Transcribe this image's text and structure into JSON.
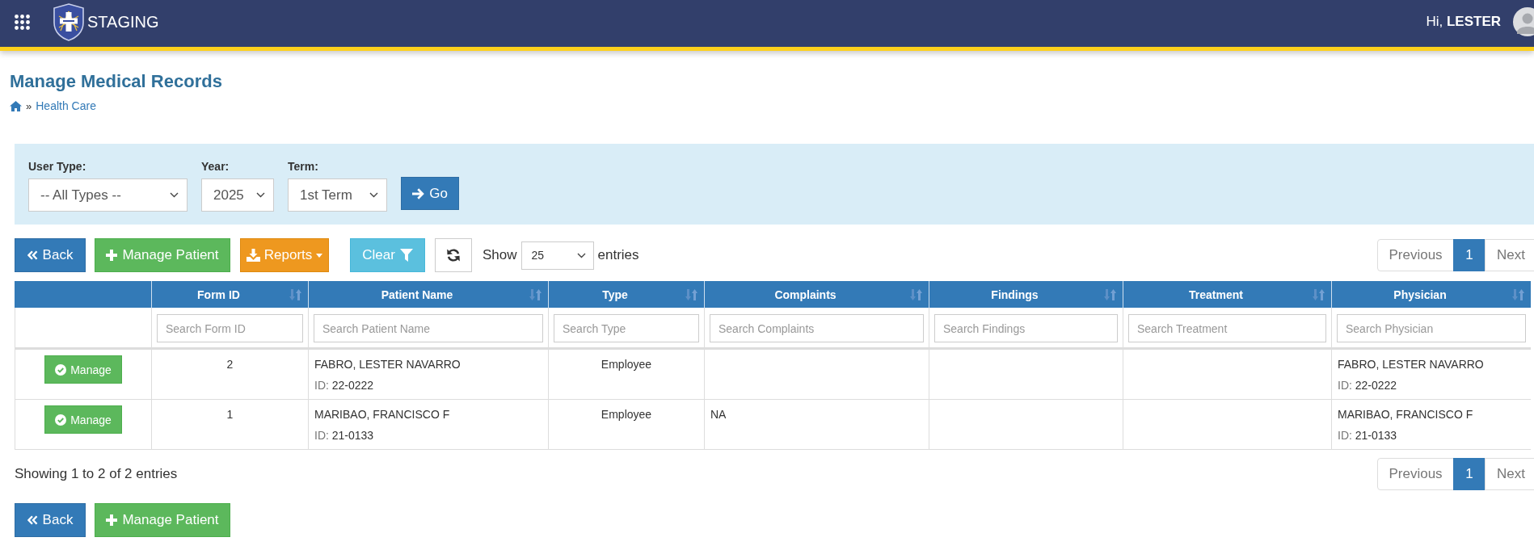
{
  "top_bar": {
    "app_title": "STAGING",
    "greeting": "Hi,",
    "user_name": "LESTER"
  },
  "page_header": {
    "title": "Manage Medical Records",
    "breadcrumb": {
      "separator": "»",
      "items": [
        {
          "label": "Health Care"
        }
      ]
    }
  },
  "filters": {
    "fields": [
      {
        "label": "User Type:",
        "value": "-- All Types --"
      },
      {
        "label": "Year:",
        "value": "2025"
      },
      {
        "label": "Term:",
        "value": "1st Term"
      }
    ],
    "go_button": {
      "label": "Go"
    }
  },
  "toolbar": {
    "buttons": [
      {
        "kind": "back",
        "label": "Back"
      },
      {
        "kind": "add",
        "label": "Manage Patient"
      },
      {
        "kind": "reports",
        "label": "Reports"
      },
      {
        "kind": "clear",
        "label": "Clear"
      },
      {
        "kind": "refresh"
      }
    ],
    "length_menu": {
      "before": "Show",
      "value": "25",
      "after": "entries"
    },
    "pagination": {
      "previous": {
        "label": "Previous",
        "disabled": true
      },
      "pages": [
        {
          "label": "1",
          "selected": true
        }
      ],
      "next": {
        "label": "Next",
        "disabled": true
      }
    }
  },
  "table": {
    "columns": [
      {
        "label": "Form ID",
        "placeholder": "Search Form ID"
      },
      {
        "label": "Patient Name",
        "placeholder": "Search Patient Name"
      },
      {
        "label": "Type",
        "placeholder": "Search Type"
      },
      {
        "label": "Complaints",
        "placeholder": "Search Complaints"
      },
      {
        "label": "Findings",
        "placeholder": "Search Findings"
      },
      {
        "label": "Treatment",
        "placeholder": "Search Treatment"
      },
      {
        "label": "Physician",
        "placeholder": "Search Physician"
      }
    ],
    "rows": [
      {
        "action": "Manage",
        "form_id": "2",
        "patient": {
          "name": "FABRO, LESTER NAVARRO",
          "id_label": "ID:",
          "id": "22-0222"
        },
        "type": "Employee",
        "physician": {
          "name": "FABRO, LESTER NAVARRO",
          "id_label": "ID:",
          "id": "22-0222"
        }
      },
      {
        "action": "Manage",
        "form_id": "1",
        "patient": {
          "name": "MARIBAO, FRANCISCO F",
          "id_label": "ID:",
          "id": "21-0133"
        },
        "type": "Employee",
        "complaints": "NA",
        "physician": {
          "name": "MARIBAO, FRANCISCO F",
          "id_label": "ID:",
          "id": "21-0133"
        }
      }
    ]
  },
  "footer": {
    "info": "Showing 1 to 2 of 2 entries",
    "pagination": {
      "previous": {
        "label": "Previous",
        "disabled": true
      },
      "pages": [
        {
          "label": "1",
          "selected": true
        }
      ],
      "next": {
        "label": "Next",
        "disabled": true
      }
    },
    "buttons": [
      {
        "kind": "back",
        "label": "Back"
      },
      {
        "kind": "add",
        "label": "Manage Patient"
      }
    ]
  }
}
